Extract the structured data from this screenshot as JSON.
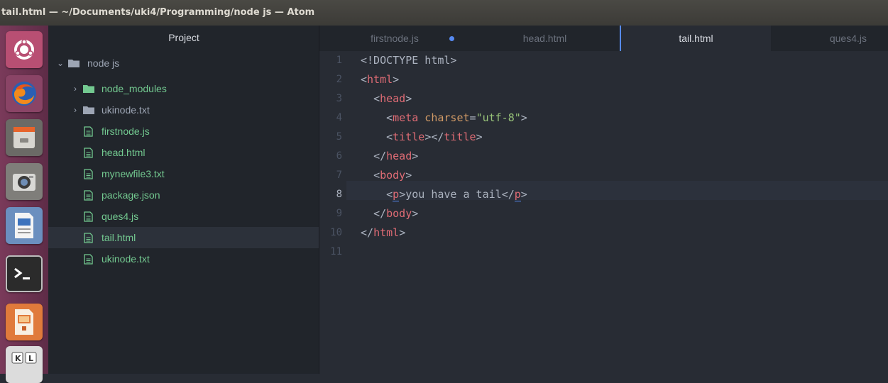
{
  "window": {
    "title": "tail.html — ~/Documents/uki4/Programming/node js — Atom"
  },
  "launcher": {
    "items": [
      {
        "name": "ubuntu-dash-icon"
      },
      {
        "name": "firefox-icon"
      },
      {
        "name": "files-icon"
      },
      {
        "name": "camera-icon"
      },
      {
        "name": "writer-icon"
      },
      {
        "name": "terminal-icon"
      },
      {
        "name": "impress-icon"
      },
      {
        "name": "keyboard-icon"
      }
    ]
  },
  "project": {
    "title": "Project",
    "root": "node js",
    "folders": [
      "node_modules",
      "ukinode.txt"
    ],
    "files": [
      "firstnode.js",
      "head.html",
      "mynewfile3.txt",
      "package.json",
      "ques4.js",
      "tail.html",
      "ukinode.txt"
    ],
    "selected": "tail.html"
  },
  "tabs": [
    {
      "label": "firstnode.js",
      "modified": true
    },
    {
      "label": "head.html",
      "modified": false
    },
    {
      "label": "tail.html",
      "modified": false,
      "active": true
    },
    {
      "label": "ques4.js",
      "modified": false
    }
  ],
  "editor": {
    "line_numbers": [
      "1",
      "2",
      "3",
      "4",
      "5",
      "6",
      "7",
      "8",
      "9",
      "10",
      "11"
    ],
    "current_line": 8,
    "lines": {
      "l1": "<!DOCTYPE html>",
      "lt": "<",
      "gt": ">",
      "ltslash": "</",
      "html": "html",
      "head": "head",
      "meta": "meta",
      "charset": " charset",
      "eq": "=",
      "utf8": "\"utf-8\"",
      "title": "title",
      "body": "body",
      "p": "p",
      "ptext": "you have a tail"
    }
  },
  "colors": {
    "accent": "#568af2",
    "tag": "#e06c75",
    "attribute": "#d19a66",
    "string": "#98c379",
    "tree_green": "#73c990"
  }
}
